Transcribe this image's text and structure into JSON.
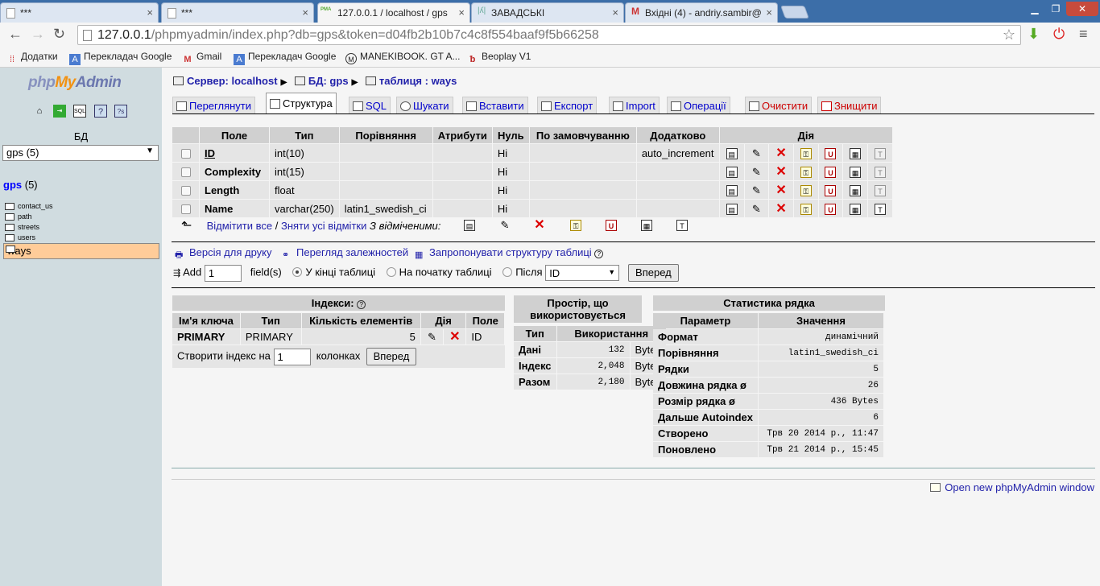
{
  "browser": {
    "tabs": [
      {
        "label": "***",
        "favicon": "page-icon"
      },
      {
        "label": "***",
        "favicon": "page-icon"
      },
      {
        "label": "127.0.0.1 / localhost / gps",
        "favicon": "PMA"
      },
      {
        "label": "ЗАВАДСЬКІ",
        "favicon": "dinosaur-icon"
      },
      {
        "label": "Вхідні (4) - andriy.sambir@",
        "favicon": "M"
      }
    ],
    "url": {
      "host": "127.0.0.1",
      "path": "/phpmyadmin/index.php?db=gps&token=d04fb2b10b7c4c8f554baaf9f5b66258"
    },
    "bookmarks": [
      {
        "label": "Додатки",
        "icon": "apps-icon"
      },
      {
        "label": "Перекладач Google",
        "icon": "translate-icon"
      },
      {
        "label": "Gmail",
        "icon": "gmail-icon"
      },
      {
        "label": "Перекладач Google",
        "icon": "translate-icon"
      },
      {
        "label": "MANEKIBOOK. GT A...",
        "icon": "M"
      },
      {
        "label": "Beoplay V1",
        "icon": "bo-icon"
      }
    ]
  },
  "sidebar": {
    "logo": {
      "php": "php",
      "my": "My",
      "admin": "Admin"
    },
    "db_label": "БД",
    "db_select": "gps (5)",
    "db_name": "gps",
    "db_count": "(5)",
    "tables": [
      "contact_us",
      "path",
      "streets",
      "users",
      "ways"
    ],
    "selected_table": "ways"
  },
  "breadcrumb": {
    "server": "Сервер: localhost",
    "db": "БД: gps",
    "table": "таблиця : ways"
  },
  "tabs": [
    {
      "label": "Переглянути",
      "active": false,
      "danger": false
    },
    {
      "label": "Структура",
      "active": true,
      "danger": false
    },
    {
      "label": "SQL",
      "active": false,
      "danger": false
    },
    {
      "label": "Шукати",
      "active": false,
      "danger": false
    },
    {
      "label": "Вставити",
      "active": false,
      "danger": false
    },
    {
      "label": "Експорт",
      "active": false,
      "danger": false
    },
    {
      "label": "Import",
      "active": false,
      "danger": false
    },
    {
      "label": "Операції",
      "active": false,
      "danger": false
    },
    {
      "label": "Очистити",
      "active": false,
      "danger": true
    },
    {
      "label": "Знищити",
      "active": false,
      "danger": true
    }
  ],
  "structure": {
    "headers": [
      "Поле",
      "Тип",
      "Порівняння",
      "Атрибути",
      "Нуль",
      "По замовчуванню",
      "Додатково",
      "Дія"
    ],
    "rows": [
      {
        "field": "ID",
        "type": "int(10)",
        "collation": "",
        "attributes": "",
        "null": "Ні",
        "default": "",
        "extra": "auto_increment"
      },
      {
        "field": "Complexity",
        "type": "int(15)",
        "collation": "",
        "attributes": "",
        "null": "Ні",
        "default": "",
        "extra": ""
      },
      {
        "field": "Length",
        "type": "float",
        "collation": "",
        "attributes": "",
        "null": "Ні",
        "default": "",
        "extra": ""
      },
      {
        "field": "Name",
        "type": "varchar(250)",
        "collation": "latin1_swedish_ci",
        "attributes": "",
        "null": "Ні",
        "default": "",
        "extra": ""
      }
    ],
    "check_all": "Відмітити все",
    "slash": " / ",
    "uncheck_all": "Зняти усі відмітки",
    "with_selected": "З відміченими:"
  },
  "links": {
    "print": "Версія для друку",
    "relations": "Перегляд залежностей",
    "propose": "Запропонувати структуру таблиці"
  },
  "add_fields": {
    "add": "Add",
    "count": "1",
    "fields": "field(s)",
    "at_end": "У кінці таблиці",
    "at_begin": "На початку таблиці",
    "after": "Після",
    "after_field": "ID",
    "go": "Вперед"
  },
  "indexes": {
    "caption": "Індекси:",
    "headers": [
      "Ім'я ключа",
      "Тип",
      "Кількість елементів",
      "Дія",
      "Поле"
    ],
    "row": {
      "name": "PRIMARY",
      "type": "PRIMARY",
      "cardinality": "5",
      "field": "ID"
    },
    "create_label": "Створити індекс на",
    "create_count": "1",
    "columns_label": "колонках",
    "go": "Вперед"
  },
  "space": {
    "caption": "Простір, що використовується",
    "headers": [
      "Тип",
      "Використання"
    ],
    "rows": [
      {
        "type": "Дані",
        "value": "132",
        "unit": "Bytes"
      },
      {
        "type": "Індекс",
        "value": "2,048",
        "unit": "Bytes"
      },
      {
        "type": "Разом",
        "value": "2,180",
        "unit": "Bytes"
      }
    ]
  },
  "rowstats": {
    "caption": "Статистика рядка",
    "headers": [
      "Параметр",
      "Значення"
    ],
    "rows": [
      {
        "param": "Формат",
        "value": "динамічний"
      },
      {
        "param": "Порівняння",
        "value": "latin1_swedish_ci"
      },
      {
        "param": "Рядки",
        "value": "5"
      },
      {
        "param": "Довжина рядка ø",
        "value": "26"
      },
      {
        "param": "Розмір рядка ø",
        "value": "436 Bytes"
      },
      {
        "param": "Дальше Autoindex",
        "value": "6"
      },
      {
        "param": "Створено",
        "value": "Трв 20 2014 р., 11:47"
      },
      {
        "param": "Поновлено",
        "value": "Трв 21 2014 р., 15:45"
      }
    ]
  },
  "open_new_window": "Open new phpMyAdmin window",
  "colors": {
    "link": "#2222aa",
    "danger": "#cc0000",
    "sidebar_bg": "#d0dce0",
    "selected_table": "#ffcc99",
    "tabstrip": "#3c6ea8"
  }
}
